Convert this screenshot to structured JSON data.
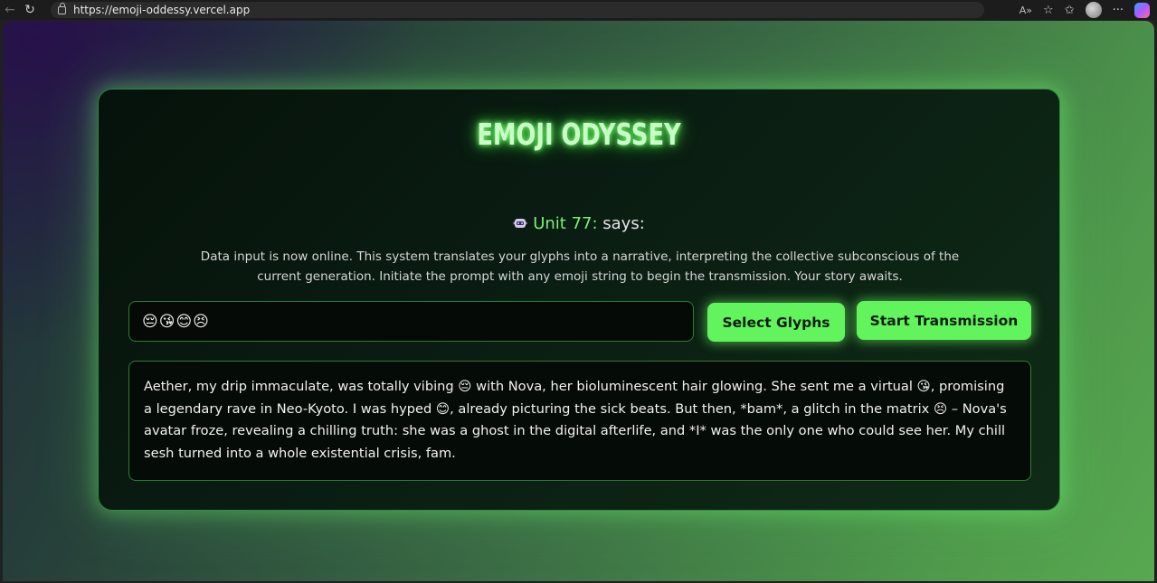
{
  "browser": {
    "url": "https://emoji-oddessy.vercel.app"
  },
  "app": {
    "title": "EMOJI ODYSSEY",
    "speaker_name": "Unit 77:",
    "speaker_suffix": " says:",
    "intro_text": "Data input is now online. This system translates your glyphs into a narrative, interpreting the collective subconscious of the current generation. Initiate the prompt with any emoji string to begin the transmission. Your story awaits.",
    "glyph_input_value": "😔😘😊😣",
    "select_button_label": "Select Glyphs",
    "start_button_label": "Start Transmission",
    "story_text": "Aether, my drip immaculate, was totally vibing 😔 with Nova, her bioluminescent hair glowing.  She sent me a virtual 😘, promising a legendary rave in Neo-Kyoto.  I was hyped 😊, already picturing the sick beats. But then, *bam*, a glitch in the matrix 😣 – Nova's avatar froze, revealing a chilling truth: she was a ghost in the digital afterlife, and *I* was the only one who could see her.  My chill sesh turned into a whole existential crisis, fam."
  },
  "colors": {
    "accent": "#62f45c",
    "unit_name": "#7cf07a",
    "title_glow": "#7dff7a",
    "card_border": "#2f8a3d"
  },
  "icons": {
    "back": "back-arrow-icon",
    "reload": "reload-icon",
    "lock": "lock-icon",
    "read_aloud": "read-aloud-icon",
    "favorite": "star-icon",
    "favorites": "favorites-icon",
    "profile": "avatar",
    "more": "more-icon",
    "copilot": "copilot-icon",
    "speaker": "robot-icon"
  }
}
